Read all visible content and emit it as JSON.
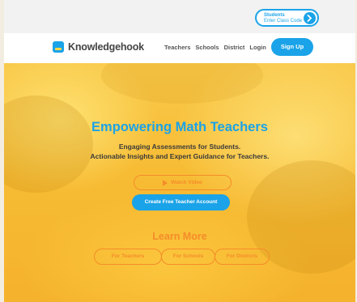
{
  "topbar": {
    "student_label": "Students",
    "class_code_label": "Enter Class Code",
    "go_icon": "chevron-right-icon"
  },
  "nav": {
    "brand": "Knowledgehook",
    "links": [
      "Teachers",
      "Schools",
      "District",
      "Login"
    ],
    "signup": "Sign Up"
  },
  "hero": {
    "title": "Empowering Math Teachers",
    "subtitle_line1": "Engaging Assessments for Students.",
    "subtitle_line2": "Actionable Insights and Expert Guidance for Teachers.",
    "watch_video": "Watch Video",
    "create_account": "Create Free Teacher Account"
  },
  "learn_more": {
    "heading": "Learn More",
    "buttons": [
      "For Teachers",
      "For Schools",
      "For Districts"
    ]
  },
  "colors": {
    "accent_blue": "#1aa3e8",
    "accent_orange": "#f58c2a",
    "hero_yellow": "#f7bc34"
  }
}
